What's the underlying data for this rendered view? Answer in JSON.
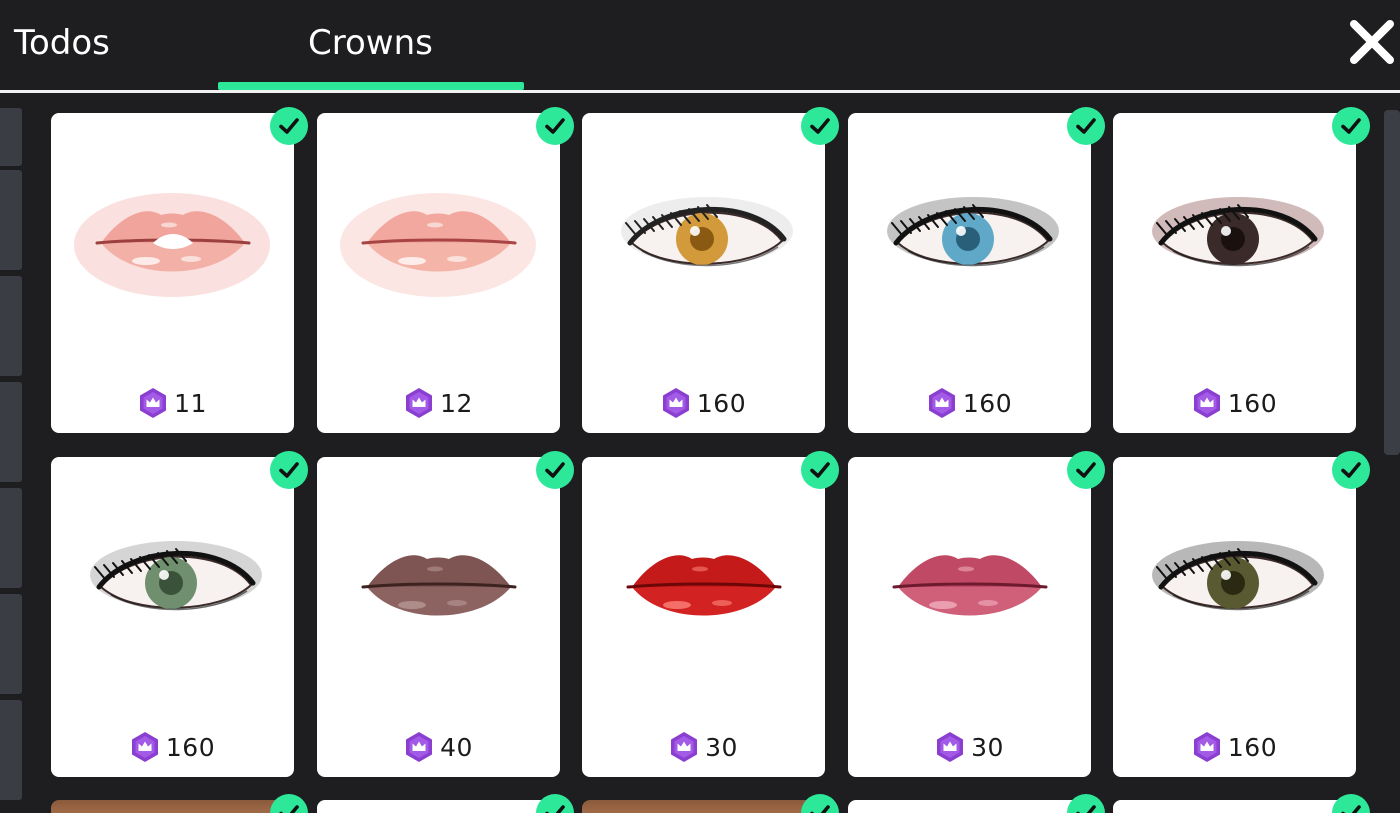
{
  "tabs": [
    {
      "label": "Todos",
      "active": false
    },
    {
      "label": "Crowns",
      "active": true
    }
  ],
  "close_icon": "close-icon",
  "accent_color": "#2ee89a",
  "currency_icon": "crown-gem-icon",
  "currency_color": "#8b3fd1",
  "items": [
    {
      "kind": "lips",
      "variant": "gloss-open",
      "price": "11",
      "owned": true
    },
    {
      "kind": "lips",
      "variant": "gloss-nude",
      "price": "12",
      "owned": true
    },
    {
      "kind": "eye",
      "variant": "amber",
      "price": "160",
      "owned": true
    },
    {
      "kind": "eye",
      "variant": "blue-smoky",
      "price": "160",
      "owned": true
    },
    {
      "kind": "eye",
      "variant": "dark-brown",
      "price": "160",
      "owned": true
    },
    {
      "kind": "eye",
      "variant": "green",
      "price": "160",
      "owned": true
    },
    {
      "kind": "lips",
      "variant": "mauve-brown",
      "price": "40",
      "owned": true
    },
    {
      "kind": "lips",
      "variant": "red",
      "price": "30",
      "owned": true
    },
    {
      "kind": "lips",
      "variant": "berry-pink",
      "price": "30",
      "owned": true
    },
    {
      "kind": "eye",
      "variant": "olive-smoky",
      "price": "160",
      "owned": true
    },
    {
      "kind": "partial",
      "variant": "skin",
      "price": "",
      "owned": true
    },
    {
      "kind": "partial",
      "variant": "white",
      "price": "",
      "owned": true
    },
    {
      "kind": "partial",
      "variant": "skin",
      "price": "",
      "owned": true
    },
    {
      "kind": "partial",
      "variant": "white",
      "price": "",
      "owned": true
    },
    {
      "kind": "partial",
      "variant": "white",
      "price": "",
      "owned": true
    }
  ]
}
